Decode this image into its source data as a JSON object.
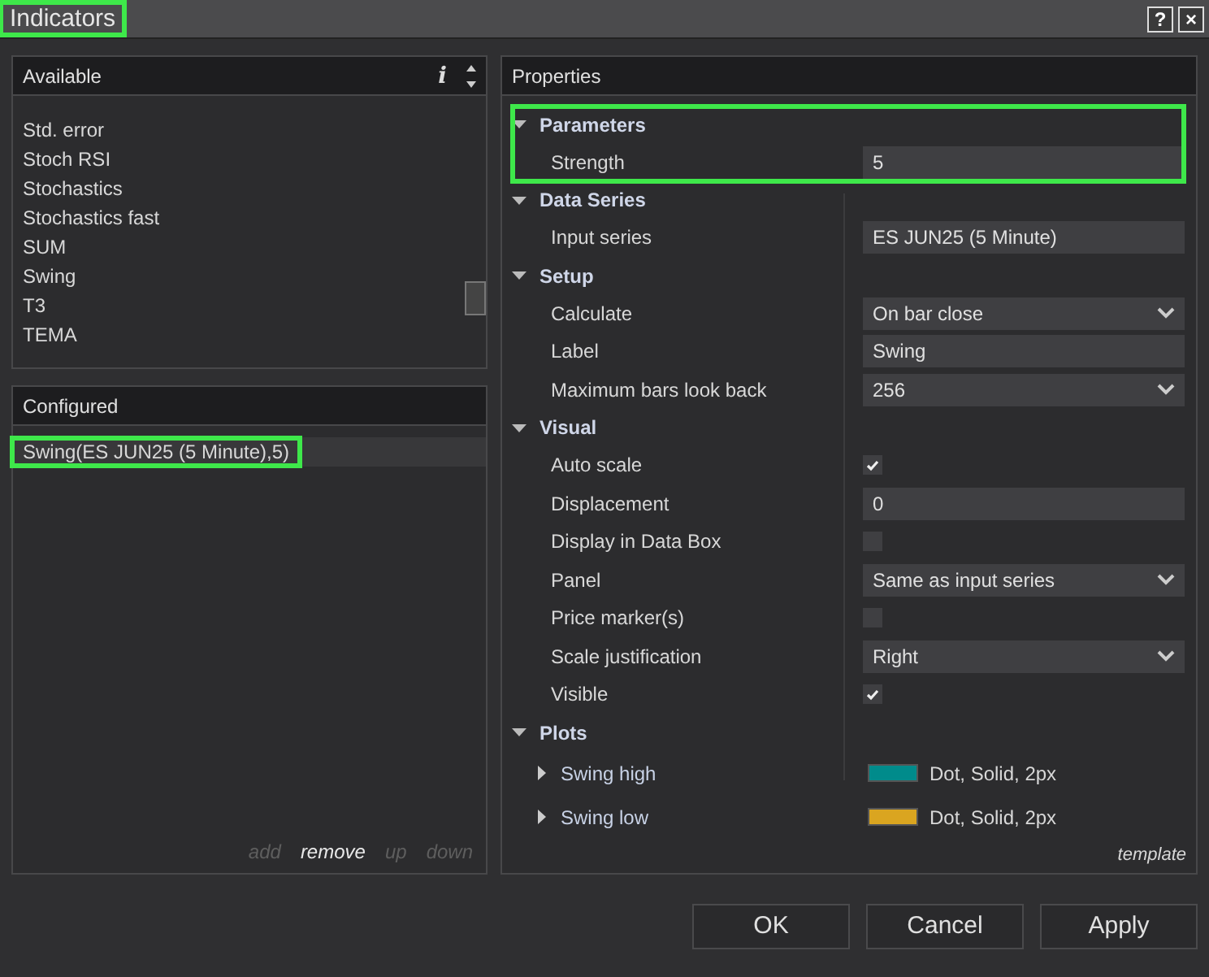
{
  "window": {
    "title": "Indicators",
    "highlighted": true,
    "buttons": [
      "?",
      "×"
    ]
  },
  "available": {
    "title": "Available",
    "info": "i",
    "items": [
      "Std. error",
      "Stoch RSI",
      "Stochastics",
      "Stochastics fast",
      "SUM",
      "Swing",
      "T3",
      "TEMA"
    ]
  },
  "configured": {
    "title": "Configured",
    "items": [
      {
        "label": "Swing(ES JUN25 (5 Minute),5)",
        "selected": true,
        "highlighted": true
      }
    ],
    "actions": [
      {
        "label": "add",
        "disabled": true
      },
      {
        "label": "remove",
        "disabled": false
      },
      {
        "label": "up",
        "disabled": true
      },
      {
        "label": "down",
        "disabled": true
      }
    ]
  },
  "properties": {
    "title": "Properties",
    "categories": [
      {
        "name": "Parameters",
        "expanded": true,
        "highlighted": true,
        "rows": [
          {
            "kind": "text",
            "label": "Strength",
            "value": "5"
          }
        ]
      },
      {
        "name": "Data Series",
        "expanded": true,
        "highlighted": false,
        "rows": [
          {
            "kind": "text",
            "label": "Input series",
            "value": "ES JUN25 (5 Minute)"
          }
        ]
      },
      {
        "name": "Setup",
        "expanded": true,
        "highlighted": false,
        "rows": [
          {
            "kind": "dropdown",
            "label": "Calculate",
            "value": "On bar close"
          },
          {
            "kind": "text",
            "label": "Label",
            "value": "Swing"
          },
          {
            "kind": "dropdown",
            "label": "Maximum bars look back",
            "value": "256"
          }
        ]
      },
      {
        "name": "Visual",
        "expanded": true,
        "highlighted": false,
        "rows": [
          {
            "kind": "checkbox",
            "label": "Auto scale",
            "checked": true
          },
          {
            "kind": "text",
            "label": "Displacement",
            "value": "0"
          },
          {
            "kind": "checkbox",
            "label": "Display in Data Box",
            "checked": false
          },
          {
            "kind": "dropdown",
            "label": "Panel",
            "value": "Same as input series"
          },
          {
            "kind": "checkbox",
            "label": "Price marker(s)",
            "checked": false
          },
          {
            "kind": "dropdown",
            "label": "Scale justification",
            "value": "Right"
          },
          {
            "kind": "checkbox",
            "label": "Visible",
            "checked": true
          }
        ]
      },
      {
        "name": "Plots",
        "expanded": true,
        "highlighted": false,
        "rows": [
          {
            "kind": "plot",
            "label": "Swing high",
            "expanded": false,
            "color": "#008b8b",
            "value": "Dot, Solid, 2px"
          },
          {
            "kind": "plot",
            "label": "Swing low",
            "expanded": false,
            "color": "#daa520",
            "value": "Dot, Solid, 2px"
          }
        ]
      }
    ],
    "template": "template"
  },
  "buttons": [
    "OK",
    "Cancel",
    "Apply"
  ]
}
